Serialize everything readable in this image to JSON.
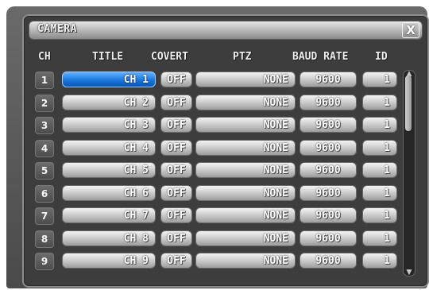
{
  "window": {
    "title": "CAMERA",
    "close_label": "X"
  },
  "headers": {
    "ch": "CH",
    "title": "TITLE",
    "covert": "COVERT",
    "ptz": "PTZ",
    "baud": "BAUD RATE",
    "id": "ID"
  },
  "rows": [
    {
      "ch": "1",
      "title": "CH 1",
      "covert": "OFF",
      "ptz": "NONE",
      "baud": "9600",
      "id": "1",
      "selected": true
    },
    {
      "ch": "2",
      "title": "CH 2",
      "covert": "OFF",
      "ptz": "NONE",
      "baud": "9600",
      "id": "1"
    },
    {
      "ch": "3",
      "title": "CH 3",
      "covert": "OFF",
      "ptz": "NONE",
      "baud": "9600",
      "id": "1"
    },
    {
      "ch": "4",
      "title": "CH 4",
      "covert": "OFF",
      "ptz": "NONE",
      "baud": "9600",
      "id": "1"
    },
    {
      "ch": "5",
      "title": "CH 5",
      "covert": "OFF",
      "ptz": "NONE",
      "baud": "9600",
      "id": "1"
    },
    {
      "ch": "6",
      "title": "CH 6",
      "covert": "OFF",
      "ptz": "NONE",
      "baud": "9600",
      "id": "1"
    },
    {
      "ch": "7",
      "title": "CH 7",
      "covert": "OFF",
      "ptz": "NONE",
      "baud": "9600",
      "id": "1"
    },
    {
      "ch": "8",
      "title": "CH 8",
      "covert": "OFF",
      "ptz": "NONE",
      "baud": "9600",
      "id": "1"
    },
    {
      "ch": "9",
      "title": "CH 9",
      "covert": "OFF",
      "ptz": "NONE",
      "baud": "9600",
      "id": "1"
    }
  ],
  "colors": {
    "selected": "#1b78de",
    "panel": "#3d3d3d"
  },
  "icons": {
    "close": "close-icon",
    "scroll_up": "chevron-up-icon",
    "scroll_down": "chevron-down-icon"
  }
}
